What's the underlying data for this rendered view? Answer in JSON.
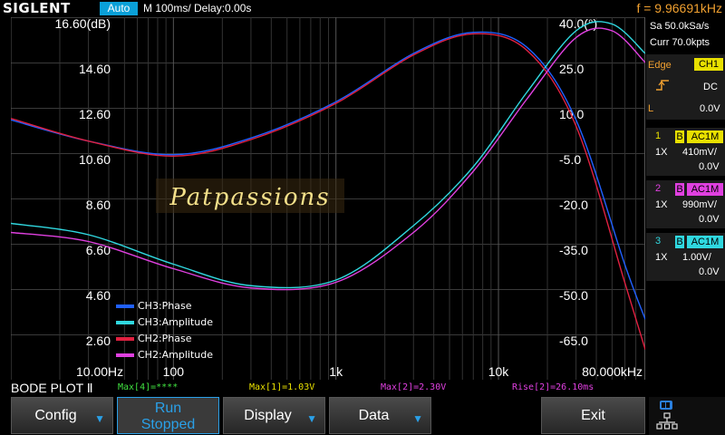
{
  "topbar": {
    "brand": "SIGLENT",
    "trigger_mode": "Auto",
    "timebase": "M 100ms/  Delay:0.00s",
    "frequency": "f = 9.96691kHz"
  },
  "acquisition": {
    "sample_rate": "Sa 50.0kSa/s",
    "memory": "Curr 70.0kpts"
  },
  "trigger": {
    "type": "Edge",
    "source": "CH1",
    "coupling": "DC",
    "slope_icon": "rising-edge-icon",
    "level_label": "L",
    "level": "0.0V"
  },
  "channels": [
    {
      "num": "1",
      "bw": "B",
      "coupling": "AC1M",
      "probe": "1X",
      "scale": "410mV/",
      "offset": "0.0V",
      "color": "#e8e000"
    },
    {
      "num": "2",
      "bw": "B",
      "coupling": "AC1M",
      "probe": "1X",
      "scale": "990mV/",
      "offset": "0.0V",
      "color": "#e040e0"
    },
    {
      "num": "3",
      "bw": "B",
      "coupling": "AC1M",
      "probe": "1X",
      "scale": "1.00V/",
      "offset": "0.0V",
      "color": "#30d8e0"
    }
  ],
  "plot": {
    "watermark": "Patpassions",
    "left_axis_ticks": [
      "16.60(dB)",
      "14.60",
      "12.60",
      "10.60",
      "8.60",
      "6.60",
      "4.60",
      "2.60"
    ],
    "right_axis_ticks": [
      "40.0(°)",
      "25.0",
      "10.0",
      "-5.0",
      "-20.0",
      "-35.0",
      "-50.0",
      "-65.0"
    ],
    "x_axis_ticks": [
      "10.00Hz",
      "100",
      "1k",
      "10k",
      "80.000kHz"
    ],
    "legend": [
      {
        "label": "CH3:Phase",
        "color": "#2060ff"
      },
      {
        "label": "CH3:Amplitude",
        "color": "#30d8e0"
      },
      {
        "label": "CH2:Phase",
        "color": "#e02040"
      },
      {
        "label": "CH2:Amplitude",
        "color": "#e040e0"
      }
    ]
  },
  "chart_data": {
    "type": "line",
    "xscale": "log",
    "xlim": [
      10,
      80000
    ],
    "ylim_left_db": [
      0.6,
      16.6
    ],
    "ylim_right_deg": [
      -80,
      40
    ],
    "series": [
      {
        "name": "CH3:Phase",
        "axis": "right",
        "color": "#2060ff",
        "x": [
          10,
          30,
          100,
          300,
          1000,
          3000,
          7000,
          15000,
          30000,
          60000,
          80000
        ],
        "y": [
          6,
          -1,
          -5.5,
          0,
          12,
          28,
          35,
          30,
          6,
          -42,
          -60
        ]
      },
      {
        "name": "CH3:Amplitude",
        "axis": "left",
        "color": "#30d8e0",
        "x": [
          10,
          30,
          100,
          300,
          1000,
          3000,
          7000,
          15000,
          30000,
          50000,
          80000
        ],
        "y": [
          7.5,
          7.0,
          5.7,
          4.75,
          5.0,
          7.4,
          10.0,
          13.3,
          16.0,
          16.3,
          15.0
        ]
      },
      {
        "name": "CH2:Phase",
        "axis": "right",
        "color": "#e02040",
        "x": [
          10,
          30,
          100,
          300,
          1000,
          3000,
          7000,
          15000,
          30000,
          60000,
          80000
        ],
        "y": [
          6.5,
          -1,
          -6,
          -0.5,
          11.5,
          27.5,
          34.5,
          29,
          4,
          -48,
          -70
        ]
      },
      {
        "name": "CH2:Amplitude",
        "axis": "left",
        "color": "#e040e0",
        "x": [
          10,
          30,
          100,
          300,
          1000,
          3000,
          7000,
          15000,
          30000,
          50000,
          80000
        ],
        "y": [
          7.1,
          6.7,
          5.5,
          4.65,
          4.9,
          7.1,
          9.8,
          13.0,
          15.7,
          16.0,
          14.6
        ]
      }
    ]
  },
  "status": {
    "title": "BODE PLOT Ⅱ",
    "max4": "Max[4]=****",
    "max1": "Max[1]=1.03V",
    "max2": "Max[2]=2.30V",
    "rise2": "Rise[2]=26.10ms"
  },
  "softkeys": {
    "config": "Config",
    "run_stopped_line1": "Run",
    "run_stopped_line2": "Stopped",
    "display": "Display",
    "data": "Data",
    "exit": "Exit"
  }
}
